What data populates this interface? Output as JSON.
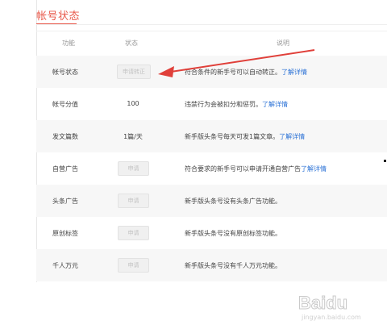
{
  "section": {
    "title": "帐号状态"
  },
  "table": {
    "headers": {
      "function": "功能",
      "status": "状态",
      "description": "说明"
    },
    "rows": [
      {
        "function": "帐号状态",
        "status_type": "button",
        "status": "申请转正",
        "description": "符合条件的新手号可以自动转正。",
        "link": "了解详情"
      },
      {
        "function": "帐号分值",
        "status_type": "text",
        "status": "100",
        "description": "违禁行为会被扣分和惩罚。",
        "link": "了解详情"
      },
      {
        "function": "发文篇数",
        "status_type": "text",
        "status": "1篇/天",
        "description": "新手版头条号每天可发1篇文章。",
        "link": "了解详情"
      },
      {
        "function": "自营广告",
        "status_type": "button",
        "status": "申请",
        "description": "符合要求的新手号可以申请开通自营广告",
        "link": "了解详情"
      },
      {
        "function": "头条广告",
        "status_type": "button",
        "status": "申请",
        "description": "新手版头条号没有头条广告功能。",
        "link": ""
      },
      {
        "function": "原创标签",
        "status_type": "button",
        "status": "申请",
        "description": "新手版头条号没有原创标签功能。",
        "link": ""
      },
      {
        "function": "千人万元",
        "status_type": "button",
        "status": "申请",
        "description": "新手版头条号没有千人万元功能。",
        "link": ""
      }
    ]
  },
  "watermark": {
    "text": "Baidu",
    "sub": "jingyan.baidu.com"
  },
  "colors": {
    "accent": "#e8584a",
    "link": "#2b72d6",
    "arrow": "#e0403a"
  }
}
